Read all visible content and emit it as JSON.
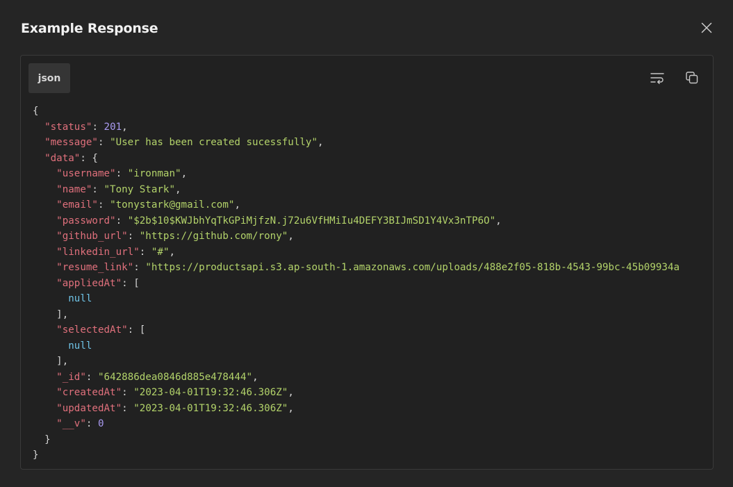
{
  "window": {
    "title": "Example Response"
  },
  "panel": {
    "language_tab": "json"
  },
  "icons": {
    "close": "close-icon",
    "wrap": "wrap-lines-icon",
    "copy": "copy-icon"
  },
  "colors": {
    "background": "#252525",
    "key": "#e0707c",
    "string": "#b3d36a",
    "number": "#a99af0",
    "null": "#6fc3e6"
  },
  "code": {
    "lines": [
      [
        {
          "t": "p",
          "v": "{"
        }
      ],
      [
        {
          "t": "p",
          "v": "  "
        },
        {
          "t": "k",
          "v": "\"status\""
        },
        {
          "t": "p",
          "v": ": "
        },
        {
          "t": "n",
          "v": "201"
        },
        {
          "t": "p",
          "v": ","
        }
      ],
      [
        {
          "t": "p",
          "v": "  "
        },
        {
          "t": "k",
          "v": "\"message\""
        },
        {
          "t": "p",
          "v": ": "
        },
        {
          "t": "s",
          "v": "\"User has been created sucessfully\""
        },
        {
          "t": "p",
          "v": ","
        }
      ],
      [
        {
          "t": "p",
          "v": "  "
        },
        {
          "t": "k",
          "v": "\"data\""
        },
        {
          "t": "p",
          "v": ": {"
        }
      ],
      [
        {
          "t": "p",
          "v": "    "
        },
        {
          "t": "k",
          "v": "\"username\""
        },
        {
          "t": "p",
          "v": ": "
        },
        {
          "t": "s",
          "v": "\"ironman\""
        },
        {
          "t": "p",
          "v": ","
        }
      ],
      [
        {
          "t": "p",
          "v": "    "
        },
        {
          "t": "k",
          "v": "\"name\""
        },
        {
          "t": "p",
          "v": ": "
        },
        {
          "t": "s",
          "v": "\"Tony Stark\""
        },
        {
          "t": "p",
          "v": ","
        }
      ],
      [
        {
          "t": "p",
          "v": "    "
        },
        {
          "t": "k",
          "v": "\"email\""
        },
        {
          "t": "p",
          "v": ": "
        },
        {
          "t": "s",
          "v": "\"tonystark@gmail.com\""
        },
        {
          "t": "p",
          "v": ","
        }
      ],
      [
        {
          "t": "p",
          "v": "    "
        },
        {
          "t": "k",
          "v": "\"password\""
        },
        {
          "t": "p",
          "v": ": "
        },
        {
          "t": "s",
          "v": "\"$2b$10$KWJbhYqTkGPiMjfzN.j72u6VfHMiIu4DEFY3BIJmSD1Y4Vx3nTP6O\""
        },
        {
          "t": "p",
          "v": ","
        }
      ],
      [
        {
          "t": "p",
          "v": "    "
        },
        {
          "t": "k",
          "v": "\"github_url\""
        },
        {
          "t": "p",
          "v": ": "
        },
        {
          "t": "s",
          "v": "\"https://github.com/rony\""
        },
        {
          "t": "p",
          "v": ","
        }
      ],
      [
        {
          "t": "p",
          "v": "    "
        },
        {
          "t": "k",
          "v": "\"linkedin_url\""
        },
        {
          "t": "p",
          "v": ": "
        },
        {
          "t": "s",
          "v": "\"#\""
        },
        {
          "t": "p",
          "v": ","
        }
      ],
      [
        {
          "t": "p",
          "v": "    "
        },
        {
          "t": "k",
          "v": "\"resume_link\""
        },
        {
          "t": "p",
          "v": ": "
        },
        {
          "t": "s",
          "v": "\"https://productsapi.s3.ap-south-1.amazonaws.com/uploads/488e2f05-818b-4543-99bc-45b09934a"
        }
      ],
      [
        {
          "t": "p",
          "v": "    "
        },
        {
          "t": "k",
          "v": "\"appliedAt\""
        },
        {
          "t": "p",
          "v": ": ["
        }
      ],
      [
        {
          "t": "p",
          "v": "      "
        },
        {
          "t": "nl",
          "v": "null"
        }
      ],
      [
        {
          "t": "p",
          "v": "    ],"
        }
      ],
      [
        {
          "t": "p",
          "v": "    "
        },
        {
          "t": "k",
          "v": "\"selectedAt\""
        },
        {
          "t": "p",
          "v": ": ["
        }
      ],
      [
        {
          "t": "p",
          "v": "      "
        },
        {
          "t": "nl",
          "v": "null"
        }
      ],
      [
        {
          "t": "p",
          "v": "    ],"
        }
      ],
      [
        {
          "t": "p",
          "v": "    "
        },
        {
          "t": "k",
          "v": "\"_id\""
        },
        {
          "t": "p",
          "v": ": "
        },
        {
          "t": "s",
          "v": "\"642886dea0846d885e478444\""
        },
        {
          "t": "p",
          "v": ","
        }
      ],
      [
        {
          "t": "p",
          "v": "    "
        },
        {
          "t": "k",
          "v": "\"createdAt\""
        },
        {
          "t": "p",
          "v": ": "
        },
        {
          "t": "s",
          "v": "\"2023-04-01T19:32:46.306Z\""
        },
        {
          "t": "p",
          "v": ","
        }
      ],
      [
        {
          "t": "p",
          "v": "    "
        },
        {
          "t": "k",
          "v": "\"updatedAt\""
        },
        {
          "t": "p",
          "v": ": "
        },
        {
          "t": "s",
          "v": "\"2023-04-01T19:32:46.306Z\""
        },
        {
          "t": "p",
          "v": ","
        }
      ],
      [
        {
          "t": "p",
          "v": "    "
        },
        {
          "t": "k",
          "v": "\"__v\""
        },
        {
          "t": "p",
          "v": ": "
        },
        {
          "t": "n",
          "v": "0"
        }
      ],
      [
        {
          "t": "p",
          "v": "  }"
        }
      ],
      [
        {
          "t": "p",
          "v": "}"
        }
      ]
    ]
  }
}
